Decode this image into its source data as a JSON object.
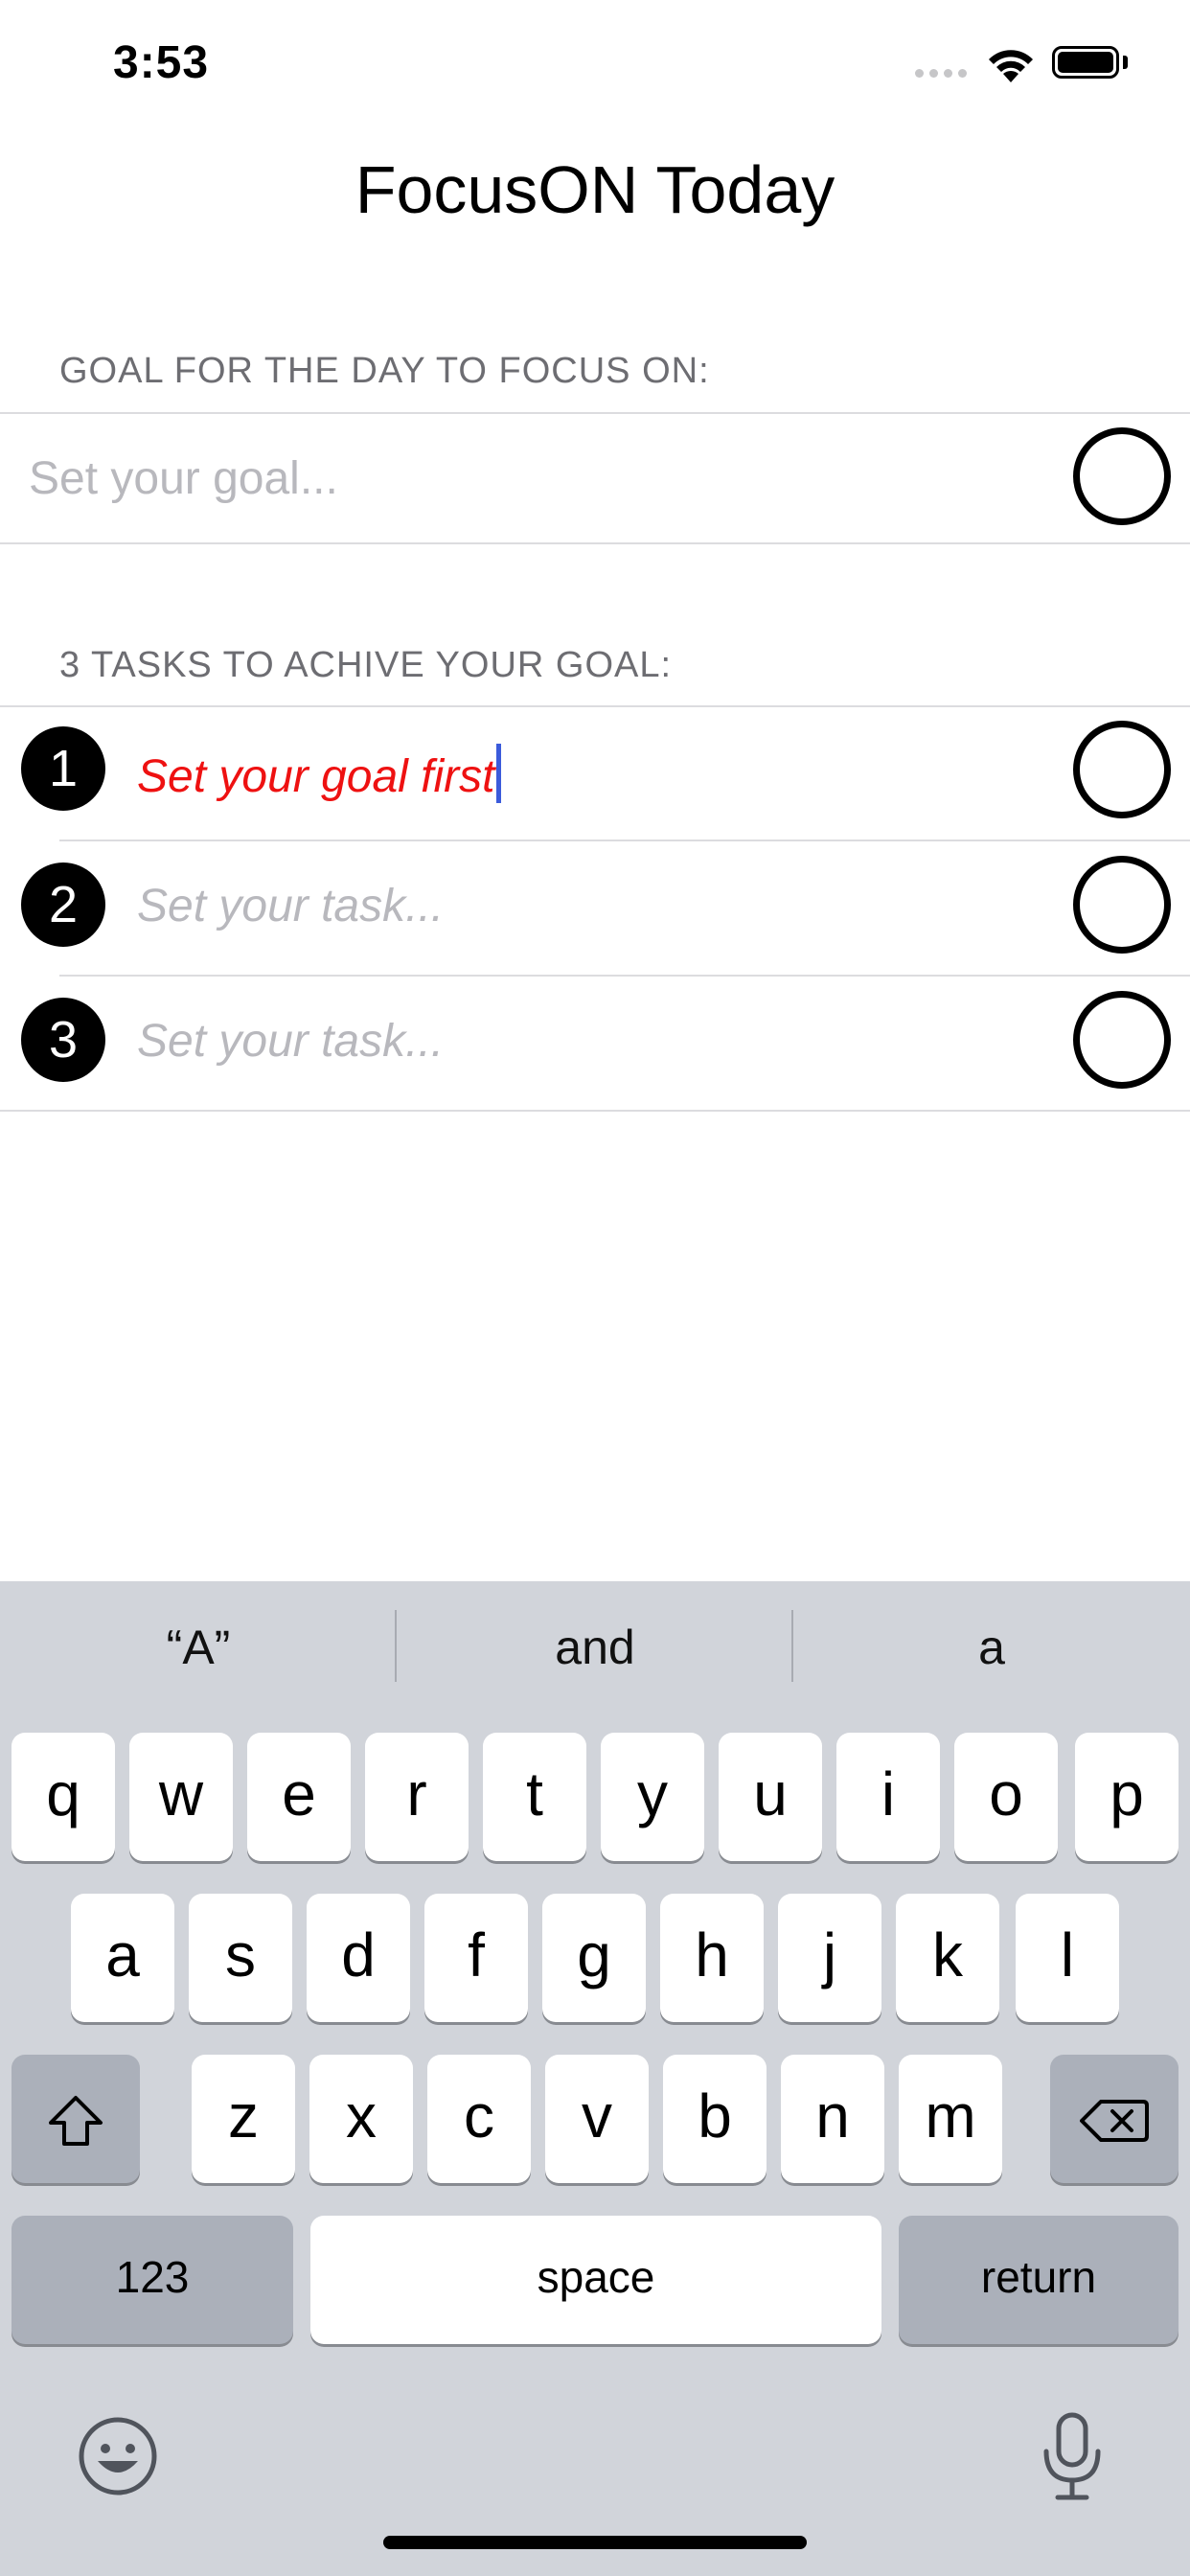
{
  "status_bar": {
    "time": "3:53"
  },
  "title": "FocusON Today",
  "goal_section": {
    "header": "GOAL FOR THE DAY TO FOCUS ON:",
    "placeholder": "Set your goal..."
  },
  "tasks_section": {
    "header": "3 TASKS TO ACHIVE YOUR GOAL:",
    "tasks": [
      {
        "number": "1",
        "text": "Set your goal first"
      },
      {
        "number": "2",
        "placeholder": "Set your task..."
      },
      {
        "number": "3",
        "placeholder": "Set your task..."
      }
    ]
  },
  "keyboard": {
    "suggestions": [
      "“A”",
      "and",
      "a"
    ],
    "row1": [
      "q",
      "w",
      "e",
      "r",
      "t",
      "y",
      "u",
      "i",
      "o",
      "p"
    ],
    "row2": [
      "a",
      "s",
      "d",
      "f",
      "g",
      "h",
      "j",
      "k",
      "l"
    ],
    "row3": [
      "z",
      "x",
      "c",
      "v",
      "b",
      "n",
      "m"
    ],
    "numbers_label": "123",
    "space_label": "space",
    "return_label": "return"
  },
  "colors": {
    "error_text": "#ee1111",
    "caret": "#3b5bdb",
    "keyboard_bg": "#d1d4da"
  }
}
